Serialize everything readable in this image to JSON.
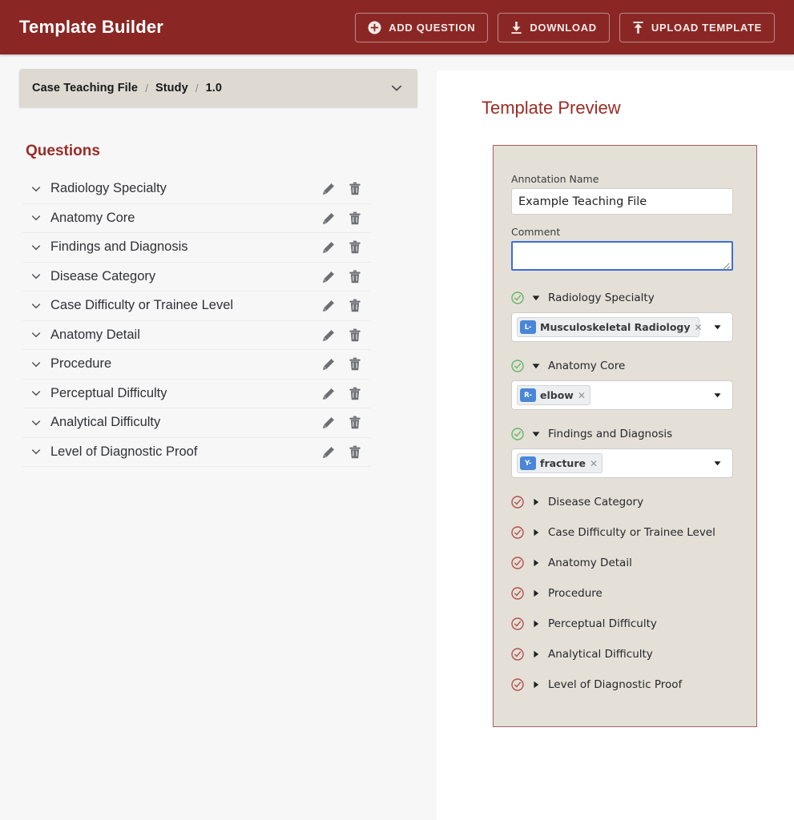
{
  "header": {
    "title": "Template Builder",
    "brand_color": "#8a2724",
    "buttons": [
      {
        "label": "ADD QUESTION",
        "icon": "plus-circle-icon"
      },
      {
        "label": "DOWNLOAD",
        "icon": "download-icon"
      },
      {
        "label": "UPLOAD TEMPLATE",
        "icon": "upload-icon"
      }
    ]
  },
  "left": {
    "breadcrumb": {
      "items": [
        "Case Teaching File",
        "Study",
        "1.0"
      ],
      "separator": "/",
      "chevron_icon": "chevron-down-icon"
    },
    "questions_heading": "Questions",
    "row_icons": {
      "collapse": "chevron-down-icon",
      "edit": "pencil-icon",
      "delete": "trash-icon"
    },
    "questions": [
      {
        "label": "Radiology Specialty"
      },
      {
        "label": "Anatomy Core"
      },
      {
        "label": "Findings and Diagnosis"
      },
      {
        "label": "Disease Category"
      },
      {
        "label": "Case Difficulty or Trainee Level"
      },
      {
        "label": "Anatomy Detail"
      },
      {
        "label": "Procedure"
      },
      {
        "label": "Perceptual Difficulty"
      },
      {
        "label": "Analytical Difficulty"
      },
      {
        "label": "Level of Diagnostic Proof"
      }
    ]
  },
  "preview": {
    "title": "Template Preview",
    "accent_color": "#9d2b25",
    "panel_bg": "#e4e0d8",
    "fields": [
      {
        "label": "Annotation Name",
        "type": "text",
        "value": "Example Teaching File",
        "placeholder": "",
        "focused": false
      },
      {
        "label": "Comment",
        "type": "textarea",
        "value": "",
        "placeholder": "",
        "focused": true
      }
    ],
    "groups": [
      {
        "label": "Radiology Specialty",
        "expanded": true,
        "status": "complete",
        "status_color": "#66b566",
        "check_icon": "check-circle-icon",
        "triangle_icon": "triangle-down-icon",
        "select": {
          "caret_icon": "caret-down-icon",
          "tags": [
            {
              "badge": "L-",
              "label": "Musculoskeletal Radiology",
              "remove_icon": "close-icon",
              "badge_color": "#4a86d8"
            }
          ]
        }
      },
      {
        "label": "Anatomy Core",
        "expanded": true,
        "status": "complete",
        "status_color": "#66b566",
        "check_icon": "check-circle-icon",
        "triangle_icon": "triangle-down-icon",
        "select": {
          "caret_icon": "caret-down-icon",
          "tags": [
            {
              "badge": "R-",
              "label": "elbow",
              "remove_icon": "close-icon",
              "badge_color": "#4a86d8"
            }
          ]
        }
      },
      {
        "label": "Findings and Diagnosis",
        "expanded": true,
        "status": "complete",
        "status_color": "#66b566",
        "check_icon": "check-circle-icon",
        "triangle_icon": "triangle-down-icon",
        "select": {
          "caret_icon": "caret-down-icon",
          "tags": [
            {
              "badge": "Y-",
              "label": "fracture",
              "remove_icon": "close-icon",
              "badge_color": "#4a86d8"
            }
          ]
        }
      },
      {
        "label": "Disease Category",
        "expanded": false,
        "status": "incomplete",
        "status_color": "#b2504c",
        "check_icon": "check-circle-icon",
        "triangle_icon": "triangle-right-icon"
      },
      {
        "label": "Case Difficulty or Trainee Level",
        "expanded": false,
        "status": "incomplete",
        "status_color": "#b2504c",
        "check_icon": "check-circle-icon",
        "triangle_icon": "triangle-right-icon"
      },
      {
        "label": "Anatomy Detail",
        "expanded": false,
        "status": "incomplete",
        "status_color": "#b2504c",
        "check_icon": "check-circle-icon",
        "triangle_icon": "triangle-right-icon"
      },
      {
        "label": "Procedure",
        "expanded": false,
        "status": "incomplete",
        "status_color": "#b2504c",
        "check_icon": "check-circle-icon",
        "triangle_icon": "triangle-right-icon"
      },
      {
        "label": "Perceptual Difficulty",
        "expanded": false,
        "status": "incomplete",
        "status_color": "#b2504c",
        "check_icon": "check-circle-icon",
        "triangle_icon": "triangle-right-icon"
      },
      {
        "label": "Analytical Difficulty",
        "expanded": false,
        "status": "incomplete",
        "status_color": "#b2504c",
        "check_icon": "check-circle-icon",
        "triangle_icon": "triangle-right-icon"
      },
      {
        "label": "Level of Diagnostic Proof",
        "expanded": false,
        "status": "incomplete",
        "status_color": "#b2504c",
        "check_icon": "check-circle-icon",
        "triangle_icon": "triangle-right-icon"
      }
    ]
  }
}
